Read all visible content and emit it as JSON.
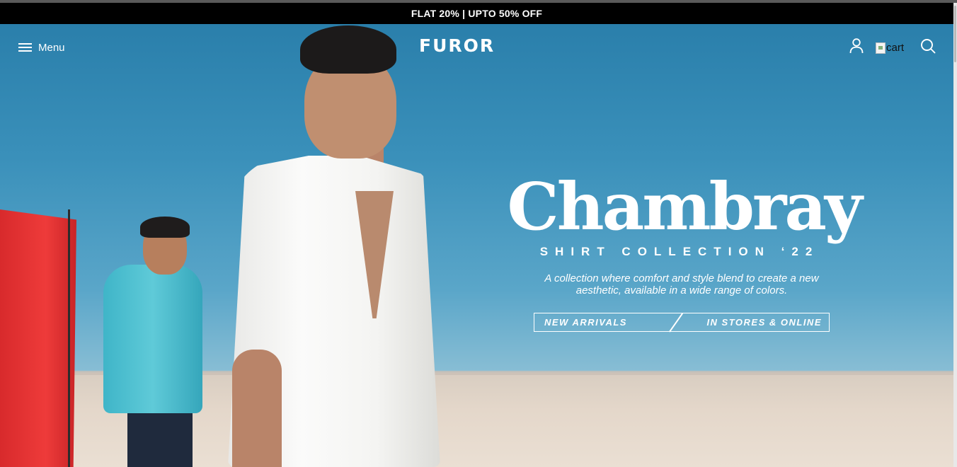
{
  "announcement": {
    "text": "FLAT 20% | UPTO 50% OFF"
  },
  "header": {
    "menu_label": "Menu",
    "logo": "FUROR",
    "icons": [
      "menu-icon",
      "user-icon",
      "cart-icon",
      "search-icon"
    ],
    "cart_alt": "cart"
  },
  "hero": {
    "headline": "Chambray",
    "subheadline": "SHIRT COLLECTION ‘22",
    "description": "A collection where comfort and style blend to create a new aesthetic, available in a wide range of colors.",
    "cta_left": "NEW ARRIVALS",
    "cta_right": "IN STORES & ONLINE"
  },
  "colors": {
    "announcement_bg": "#000000",
    "text": "#ffffff",
    "sky": "#2a7fab",
    "sand": "#e4d7ca",
    "flag": "#ee3b3a"
  }
}
